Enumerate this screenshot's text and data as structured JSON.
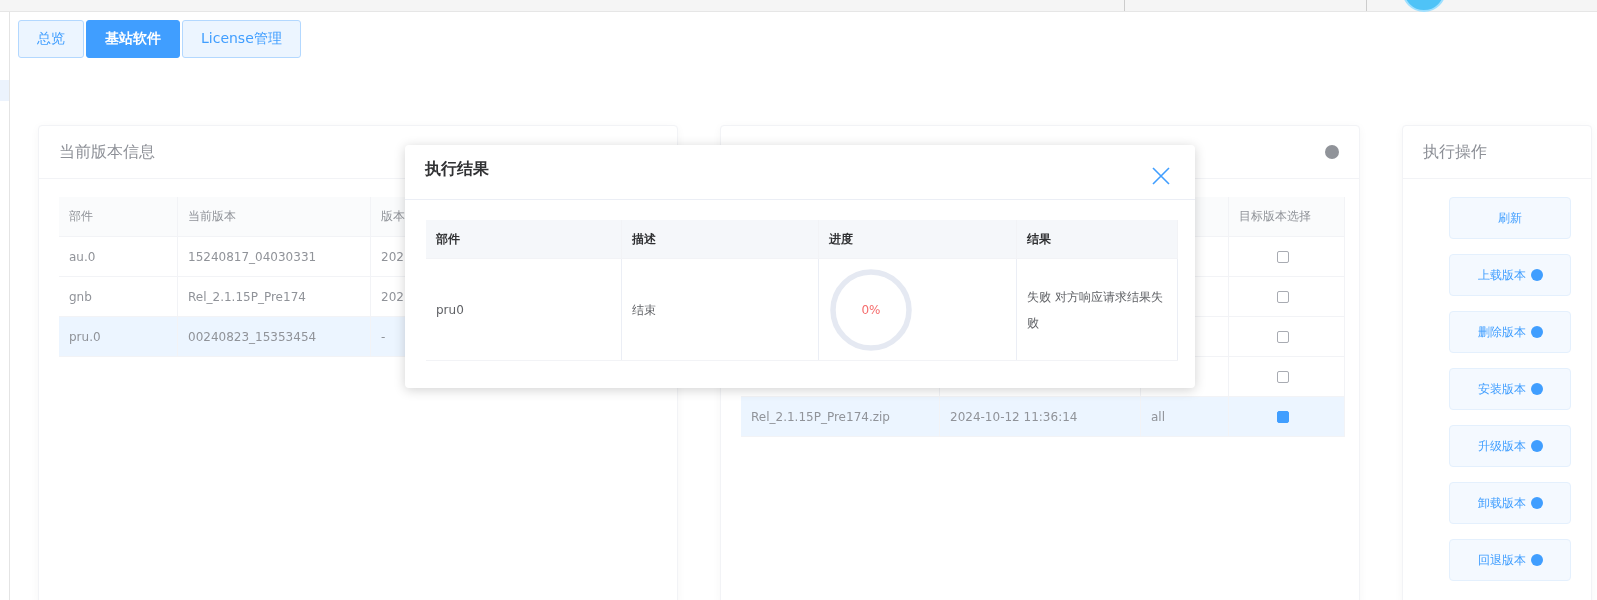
{
  "tabs": [
    {
      "label": "总览",
      "selected": false
    },
    {
      "label": "基站软件",
      "selected": true
    },
    {
      "label": "License管理",
      "selected": false
    }
  ],
  "current_version": {
    "title": "当前版本信息",
    "columns": [
      "部件",
      "当前版本",
      "版本"
    ],
    "rows": [
      {
        "cells": [
          "au.0",
          "15240817_04030331",
          "202"
        ],
        "selected": false
      },
      {
        "cells": [
          "gnb",
          "Rel_2.1.15P_Pre174",
          "202"
        ],
        "selected": false
      },
      {
        "cells": [
          "pru.0",
          "00240823_15353454",
          "-"
        ],
        "selected": true
      }
    ]
  },
  "target_versions": {
    "column_4": "目标版本选择",
    "rows": [
      {
        "checked": false
      },
      {
        "checked": false
      },
      {
        "checked": false
      },
      {
        "checked": false
      },
      {
        "file": "Rel_2.1.15P_Pre174.zip",
        "time": "2024-10-12 11:36:14",
        "scope": "all",
        "checked": true
      }
    ]
  },
  "actions": {
    "title": "执行操作",
    "buttons": [
      {
        "label": "刷新",
        "info": false
      },
      {
        "label": "上载版本",
        "info": true
      },
      {
        "label": "删除版本",
        "info": true
      },
      {
        "label": "安装版本",
        "info": true
      },
      {
        "label": "升级版本",
        "info": true
      },
      {
        "label": "卸载版本",
        "info": true
      },
      {
        "label": "回退版本",
        "info": true
      }
    ]
  },
  "dialog": {
    "title": "执行结果",
    "columns": [
      "部件",
      "描述",
      "进度",
      "结果"
    ],
    "rows": [
      {
        "part": "pru0",
        "description": "结束",
        "progress": {
          "level": 0,
          "reading": "0%"
        },
        "result": "失败 对方响应请求结果失败"
      }
    ]
  }
}
